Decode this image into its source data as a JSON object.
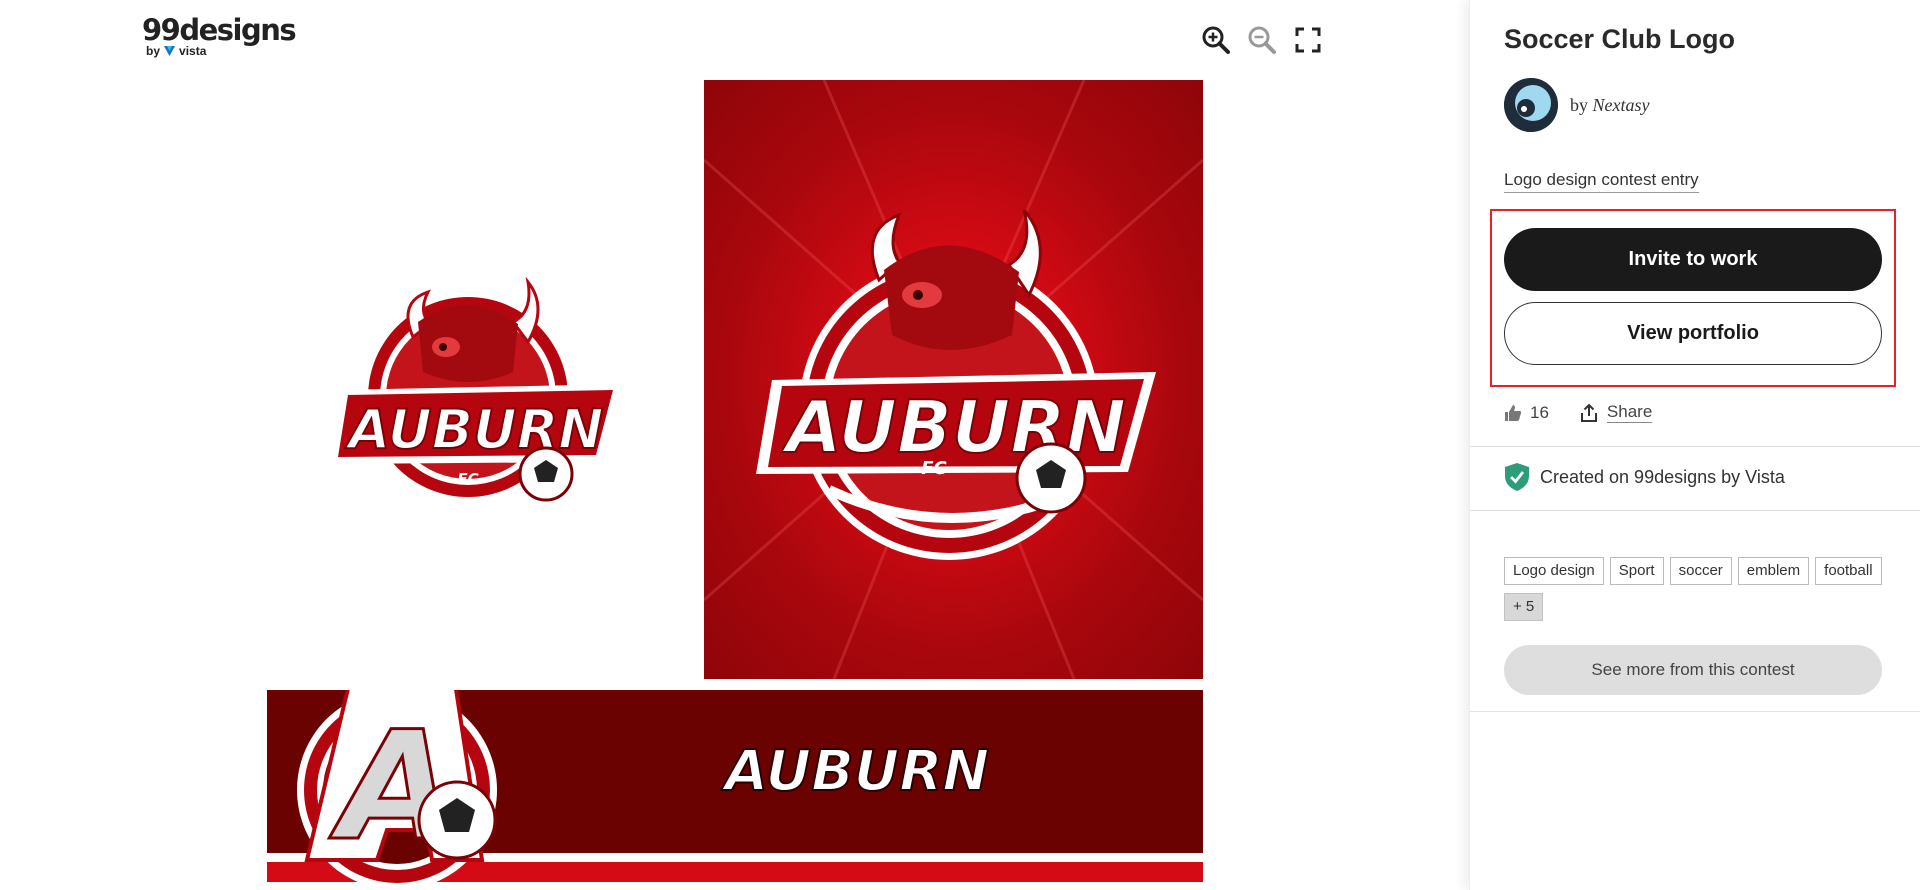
{
  "brand": {
    "name": "99designs",
    "sub_by": "by",
    "sub_name": "vista"
  },
  "zoom": {
    "zoom_in": "zoom-in-icon",
    "zoom_out": "zoom-out-icon",
    "fullscreen": "fullscreen-icon"
  },
  "artwork": {
    "wordmark": "AUBURN",
    "sub": "FC",
    "monogram": "A",
    "colors": {
      "red": "#d40a14",
      "dark_red": "#6b0202"
    }
  },
  "sidebar": {
    "title": "Soccer Club Logo",
    "by": "by",
    "designer": "Nextasy",
    "entry_link": "Logo design contest entry",
    "invite_label": "Invite to work",
    "portfolio_label": "View portfolio",
    "likes": "16",
    "share_label": "Share",
    "created_text": "Created on 99designs by Vista",
    "tags": [
      "Logo design",
      "Sport",
      "soccer",
      "emblem",
      "football"
    ],
    "more_tags": "+ 5",
    "contest_label": "See more from this contest",
    "highlight_color": "#e8202a"
  }
}
